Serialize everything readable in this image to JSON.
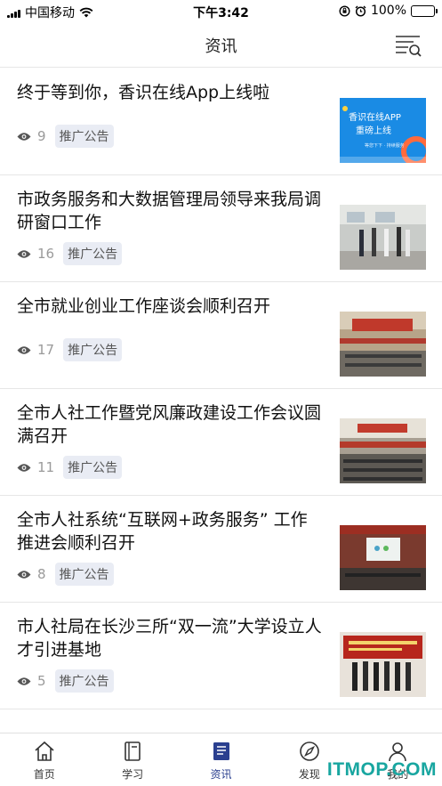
{
  "status_bar": {
    "carrier": "中国移动",
    "time": "下午3:42",
    "battery": "100%"
  },
  "nav": {
    "title": "资讯",
    "menu_icon": "list-search-icon"
  },
  "tag_label": "推广公告",
  "articles": [
    {
      "title": "终于等到你，香识在线App上线啦",
      "views": "9",
      "tag": "推广公告",
      "thumb_text_1": "香识在线APP",
      "thumb_text_2": "重磅上线",
      "thumb_caption": "等您下下 · 持续服务"
    },
    {
      "title": "市政务服务和大数据管理局领导来我局调研窗口工作",
      "views": "16",
      "tag": "推广公告"
    },
    {
      "title": "全市就业创业工作座谈会顺利召开",
      "views": "17",
      "tag": "推广公告"
    },
    {
      "title": "全市人社工作暨党风廉政建设工作会议圆满召开",
      "views": "11",
      "tag": "推广公告"
    },
    {
      "title": "全市人社系统“互联网+政务服务” 工作推进会顺利召开",
      "views": "8",
      "tag": "推广公告"
    },
    {
      "title": "市人社局在长沙三所“双一流”大学设立人才引进基地",
      "views": "5",
      "tag": "推广公告"
    }
  ],
  "tabs": [
    {
      "label": "首页",
      "icon": "home-icon"
    },
    {
      "label": "学习",
      "icon": "book-icon"
    },
    {
      "label": "资讯",
      "icon": "news-icon",
      "active": true
    },
    {
      "label": "发现",
      "icon": "compass-icon"
    },
    {
      "label": "我的",
      "icon": "user-icon"
    }
  ],
  "watermark": "ITMOP.COM",
  "colors": {
    "accent": "#2a3f8f",
    "tag_bg": "#e9ecf4",
    "watermark": "#18a6a0"
  }
}
